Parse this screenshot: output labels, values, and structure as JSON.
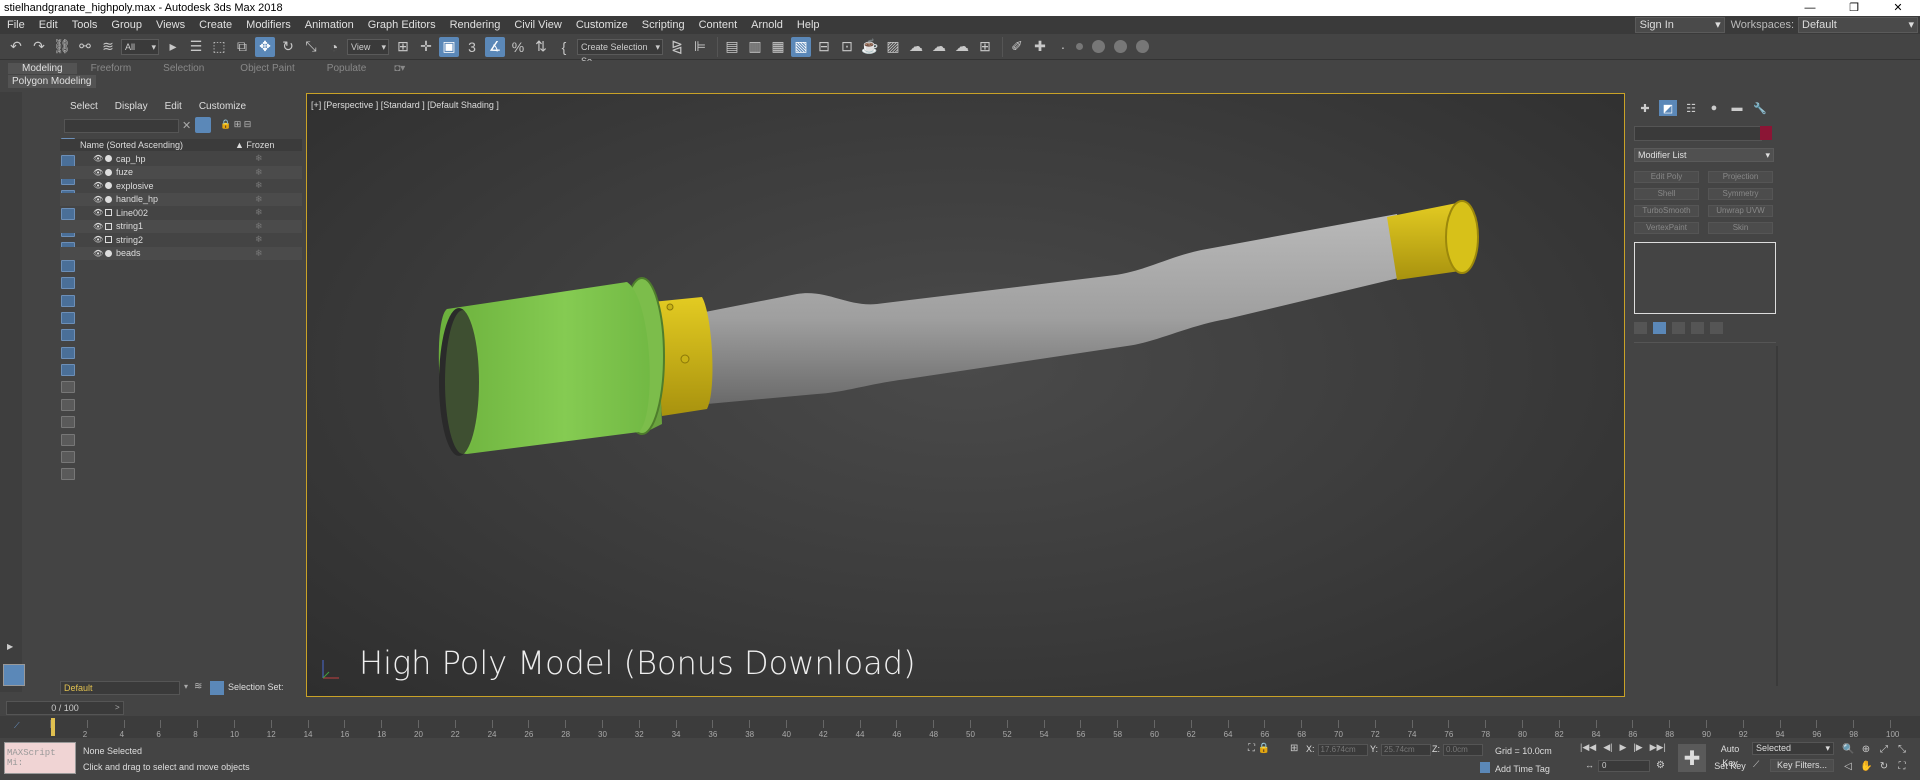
{
  "window": {
    "title": "stielhandgranate_highpoly.max - Autodesk 3ds Max 2018",
    "controls": [
      "—",
      "❐",
      "✕"
    ]
  },
  "menu": [
    "File",
    "Edit",
    "Tools",
    "Group",
    "Views",
    "Create",
    "Modifiers",
    "Animation",
    "Graph Editors",
    "Rendering",
    "Civil View",
    "Customize",
    "Scripting",
    "Content",
    "Arnold",
    "Help"
  ],
  "account": {
    "signin": "Sign In",
    "workspaces_label": "Workspaces:",
    "workspace": "Default"
  },
  "toolbar": {
    "filter": "All",
    "ref_coord": "View",
    "selection_set": "Create Selection Se"
  },
  "ribbon": {
    "tabs": [
      "Modeling",
      "Freeform",
      "Selection",
      "Object Paint",
      "Populate"
    ],
    "active_tab": "Modeling",
    "sub_panel": "Polygon Modeling"
  },
  "scene_explorer": {
    "tabs": [
      "Select",
      "Display",
      "Edit",
      "Customize"
    ],
    "header_name": "Name (Sorted Ascending)",
    "header_frozen": "▲ Frozen",
    "objects": [
      {
        "name": "cap_hp",
        "kind": "geometry"
      },
      {
        "name": "fuze",
        "kind": "geometry"
      },
      {
        "name": "explosive",
        "kind": "geometry"
      },
      {
        "name": "handle_hp",
        "kind": "geometry"
      },
      {
        "name": "Line002",
        "kind": "shape"
      },
      {
        "name": "string1",
        "kind": "shape"
      },
      {
        "name": "string2",
        "kind": "shape"
      },
      {
        "name": "beads",
        "kind": "geometry"
      }
    ],
    "layer": "Default",
    "selection_set_label": "Selection Set:"
  },
  "viewport": {
    "label": "[+] [Perspective ] [Standard ] [Default Shading ]",
    "overlay_text": "High Poly Model (Bonus Download)",
    "colors": {
      "cap": "#7fc44c",
      "fuze": "#c9b214",
      "handle": "#a3a3a3",
      "border": "#c9a227"
    }
  },
  "command_panel": {
    "modifier_list": "Modifier List",
    "modifiers": [
      "Edit Poly",
      "Projection",
      "Shell",
      "Symmetry",
      "TurboSmooth",
      "Unwrap UVW",
      "VertexPaint",
      "Skin"
    ],
    "object_color": "#8b1535"
  },
  "timeline": {
    "slider": "0 / 100",
    "ticks": [
      0,
      2,
      4,
      6,
      8,
      10,
      12,
      14,
      16,
      18,
      20,
      22,
      24,
      26,
      28,
      30,
      32,
      34,
      36,
      38,
      40,
      42,
      44,
      46,
      48,
      50,
      52,
      54,
      56,
      58,
      60,
      62,
      64,
      66,
      68,
      70,
      72,
      74,
      76,
      78,
      80,
      82,
      84,
      86,
      88,
      90,
      92,
      94,
      96,
      98,
      100
    ]
  },
  "status": {
    "maxscript": "MAXScript Mi:",
    "selection": "None Selected",
    "prompt": "Click and drag to select and move objects",
    "x_label": "X:",
    "x_value": "17.674cm",
    "y_label": "Y:",
    "y_value": "25.74cm",
    "z_label": "Z:",
    "z_value": "0.0cm",
    "grid": "Grid = 10.0cm",
    "add_time_tag": "Add Time Tag",
    "frame": "0",
    "auto_key": "Auto Key",
    "set_key": "Set Key",
    "selected": "Selected",
    "key_filters": "Key Filters..."
  }
}
